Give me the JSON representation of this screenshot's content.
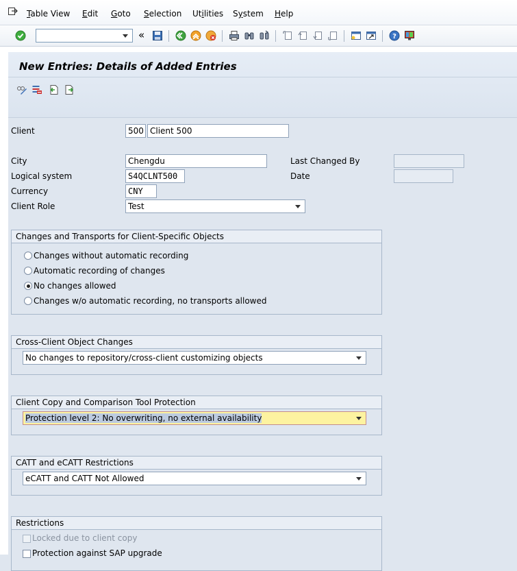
{
  "menu": {
    "items": [
      "Table View",
      "Edit",
      "Goto",
      "Selection",
      "Utilities",
      "System",
      "Help"
    ],
    "underline": [
      "T",
      "E",
      "G",
      "S",
      "i",
      "y",
      "H"
    ]
  },
  "toolbar": {
    "command_field_value": "",
    "icons": [
      "enter-icon",
      "back-icon",
      "save-icon",
      "exit-icon",
      "stop-icon",
      "cancel-icon",
      "print-icon",
      "find-icon",
      "find-next-icon",
      "first-page-icon",
      "previous-page-icon",
      "next-page-icon",
      "last-page-icon",
      "create-session-icon",
      "shortcut-icon",
      "help-icon",
      "layout-icon"
    ]
  },
  "title": "New Entries: Details of Added Entries",
  "app_toolbar_icons": [
    "change-display-icon",
    "delete-icon",
    "previous-entry-icon",
    "next-entry-icon"
  ],
  "form": {
    "client_label": "Client",
    "client_value": "500",
    "client_desc": "Client 500",
    "city_label": "City",
    "city_value": "Chengdu",
    "last_changed_by_label": "Last Changed By",
    "last_changed_by_value": "",
    "logical_system_label": "Logical system",
    "logical_system_value": "S4QCLNT500",
    "date_label": "Date",
    "date_value": "",
    "currency_label": "Currency",
    "currency_value": "CNY",
    "client_role_label": "Client Role",
    "client_role_value": "Test"
  },
  "changes_group": {
    "title": "Changes and Transports for Client-Specific Objects",
    "options": [
      {
        "label": "Changes without automatic recording",
        "selected": false
      },
      {
        "label": "Automatic recording of changes",
        "selected": false
      },
      {
        "label": "No changes allowed",
        "selected": true
      },
      {
        "label": "Changes w/o automatic recording, no transports allowed",
        "selected": false
      }
    ]
  },
  "cross_client_group": {
    "title": "Cross-Client Object Changes",
    "value": "No changes to repository/cross-client customizing objects"
  },
  "copy_protection_group": {
    "title": "Client Copy and Comparison Tool Protection",
    "value": "Protection level 2: No overwriting, no external availability"
  },
  "catt_group": {
    "title": "CATT and eCATT Restrictions",
    "value": "eCATT and CATT Not Allowed"
  },
  "restrictions_group": {
    "title": "Restrictions",
    "locked_label": "Locked due to client copy",
    "locked_checked": false,
    "protection_label": "Protection against SAP upgrade",
    "protection_checked": false
  },
  "colors": {
    "form_bg": "#dfe6ef",
    "highlight_yellow": "#fdf3a0",
    "group_border": "#a7b7ca"
  }
}
